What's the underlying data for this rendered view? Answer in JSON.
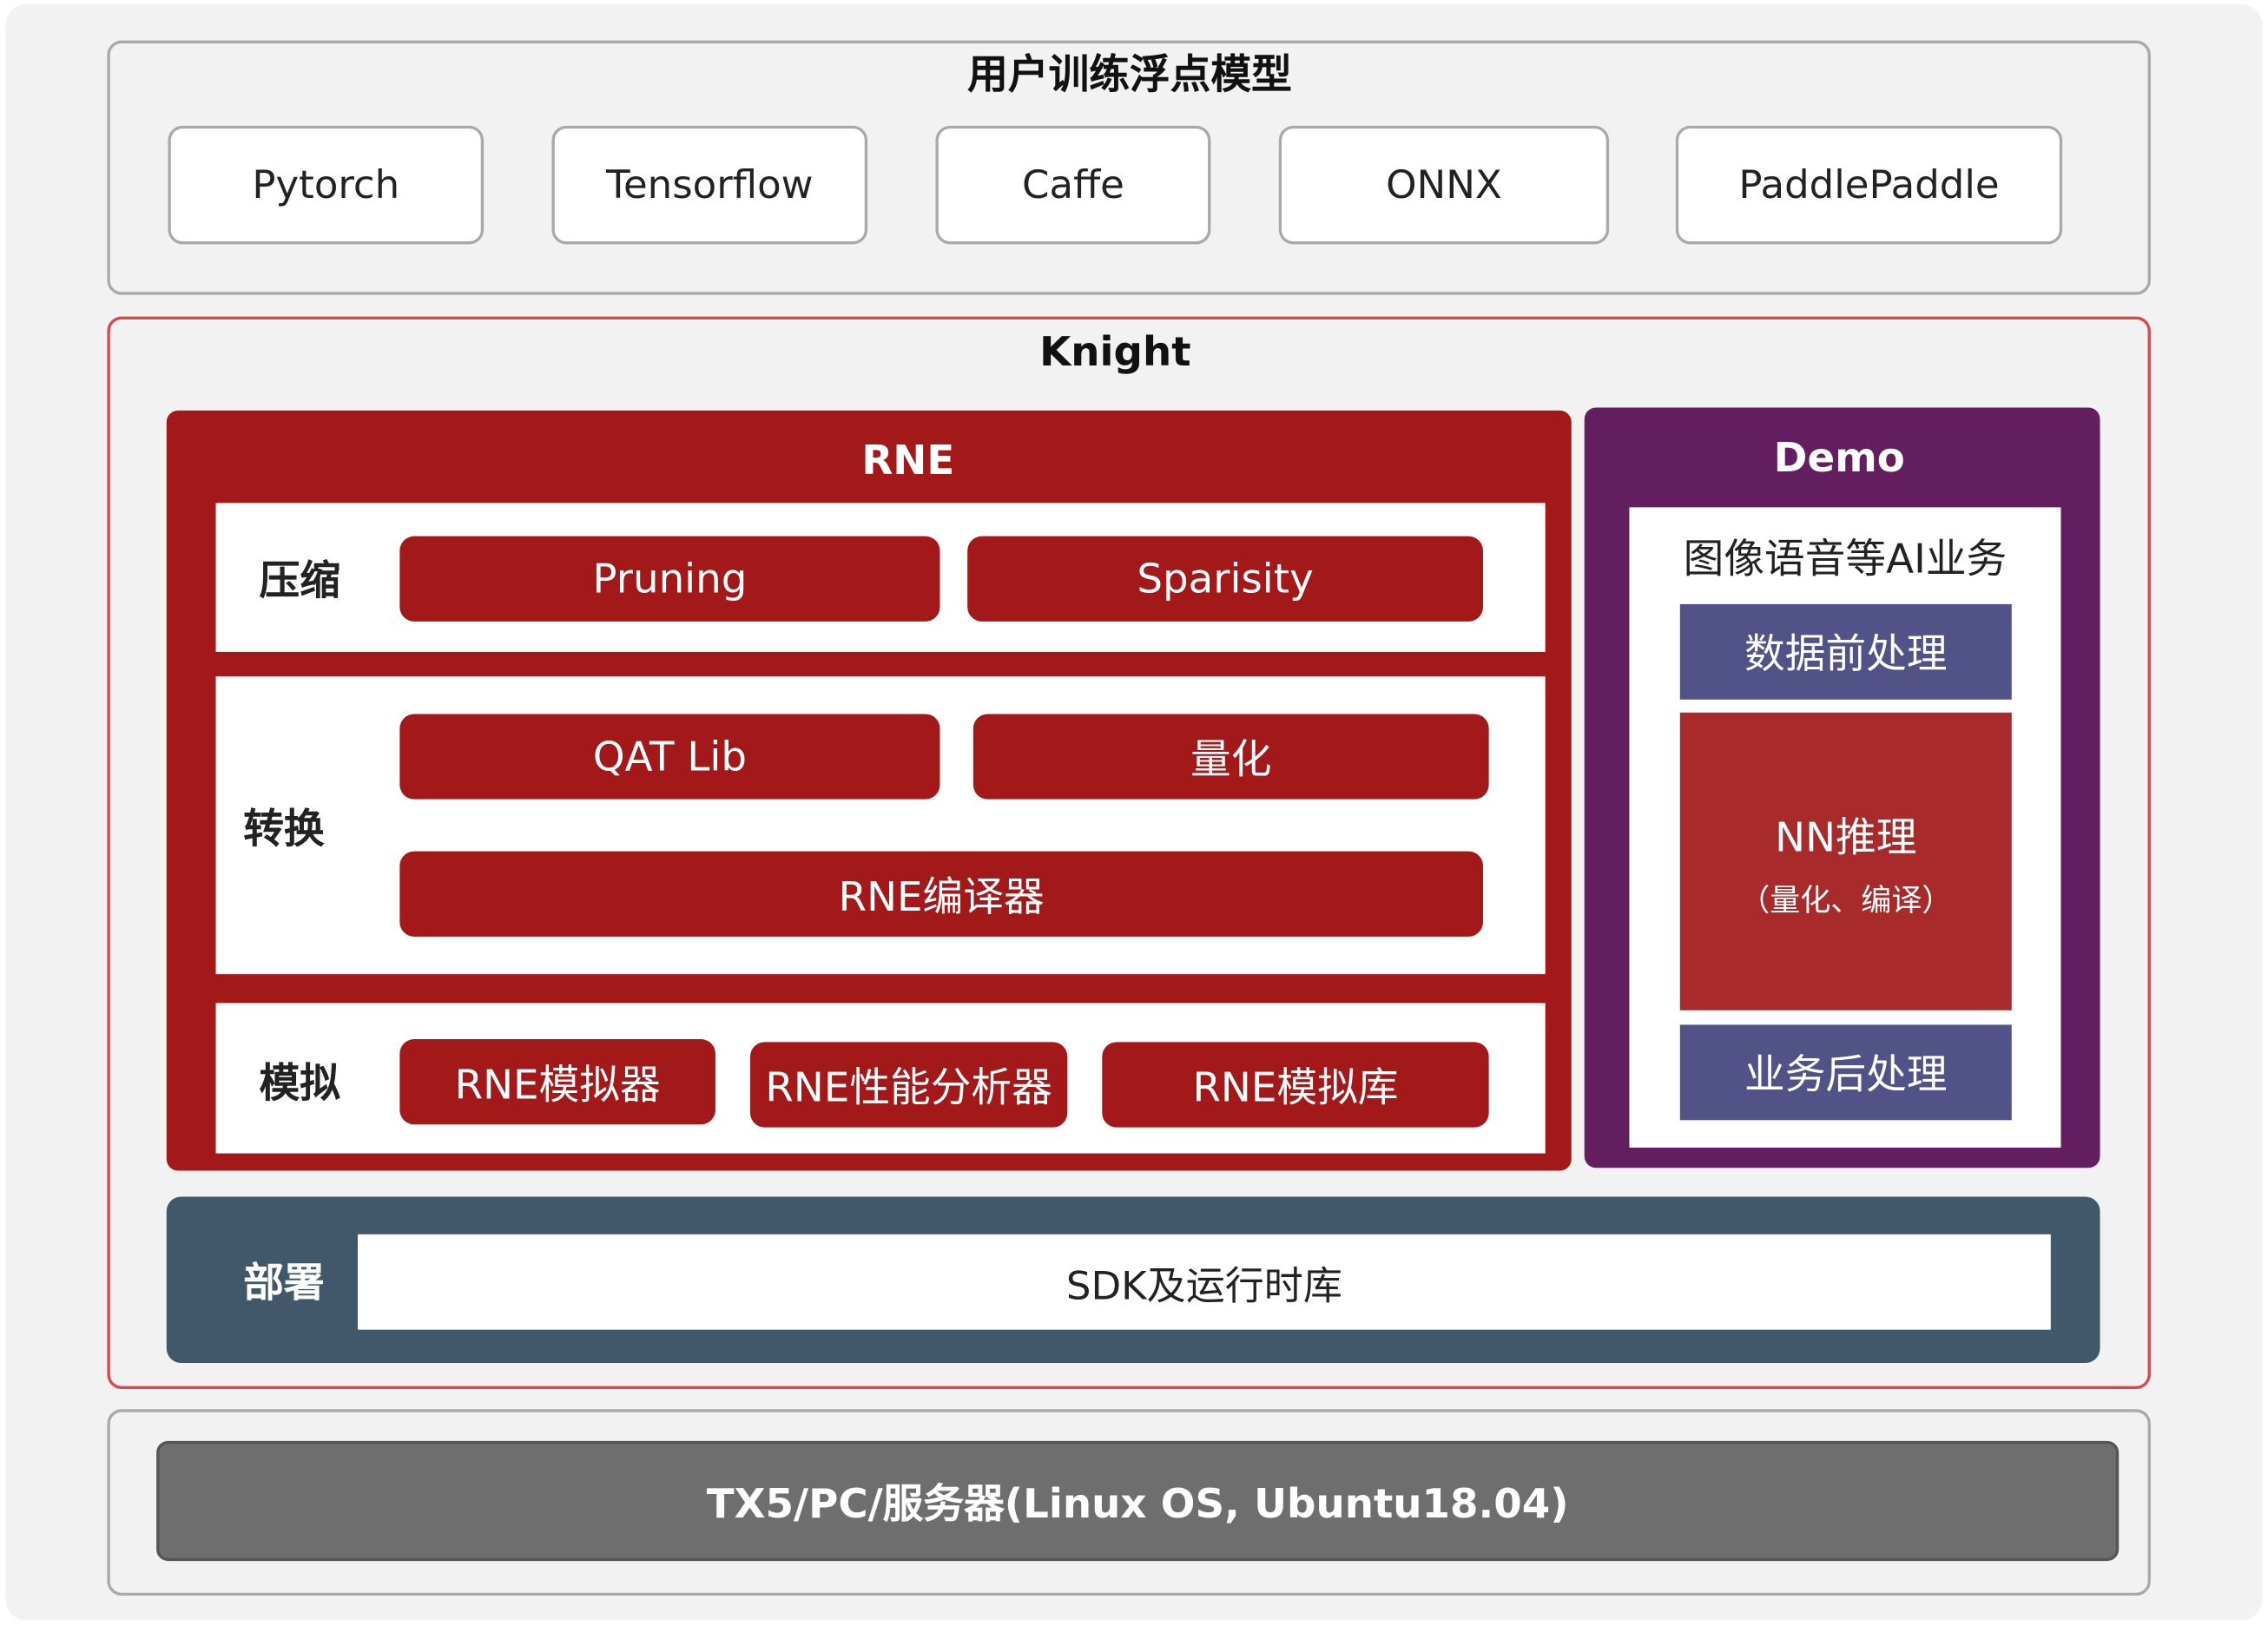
{
  "colors": {
    "background": "#f2f2f2",
    "rne_red": "#a31818",
    "demo_purple": "#621e5e",
    "demo_blue": "#505288",
    "nn_red": "#a82a2a",
    "deploy_slate": "#405869",
    "os_gray": "#6e6e6e",
    "knight_border": "#d44a4a"
  },
  "top_section": {
    "title": "用户训练浮点模型",
    "frameworks": [
      "Pytorch",
      "Tensorflow",
      "Caffe",
      "ONNX",
      "PaddlePaddle"
    ]
  },
  "knight": {
    "title": "Knight",
    "rne": {
      "title": "RNE",
      "compress": {
        "label": "压缩",
        "items": [
          "Pruning",
          "Sparisity"
        ]
      },
      "convert": {
        "label": "转换",
        "items": [
          "QAT Lib",
          "量化",
          "RNE编译器"
        ]
      },
      "simulate": {
        "label": "模拟",
        "items": [
          "RNE模拟器",
          "RNE性能分析器",
          "RNE模拟库"
        ]
      }
    },
    "demo": {
      "title": "Demo",
      "subtitle": "图像语音等AI业务",
      "preprocess": "数据前处理",
      "nn_title": "NN推理",
      "nn_subtitle": "（量化、编译）",
      "postprocess": "业务后处理"
    },
    "deploy": {
      "label": "部署",
      "content": "SDK及运行时库"
    }
  },
  "platform": {
    "label": "TX5/PC/服务器(Linux OS, Ubuntu18.04)"
  }
}
